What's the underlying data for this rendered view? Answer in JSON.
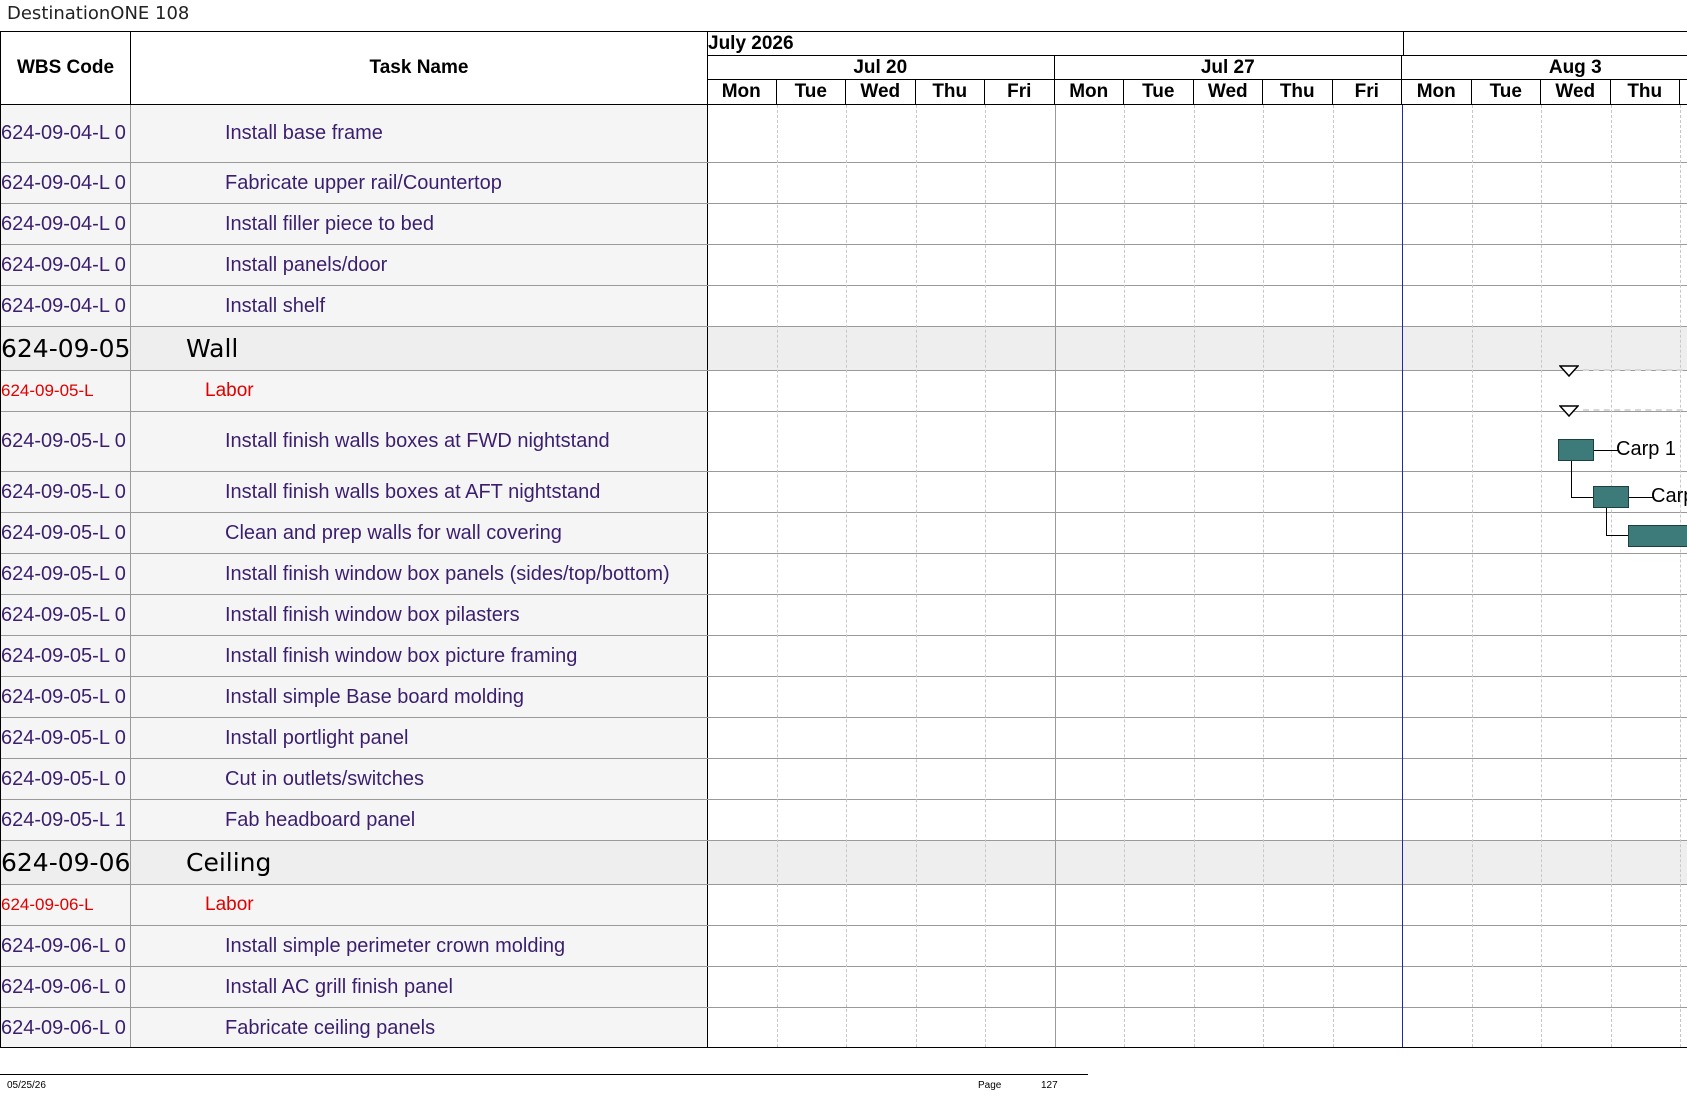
{
  "document": {
    "title": "DestinationONE 108"
  },
  "columns": {
    "wbs": "WBS Code",
    "task": "Task Name"
  },
  "timeline": {
    "month_label": "July 2026",
    "weeks": [
      "Jul 20",
      "Jul 27",
      "Aug 3"
    ],
    "days": [
      "Mon",
      "Tue",
      "Wed",
      "Thu",
      "Fri",
      "Mon",
      "Tue",
      "Wed",
      "Thu",
      "Fri",
      "Mon",
      "Tue",
      "Wed",
      "Thu"
    ]
  },
  "rows": [
    {
      "kind": "task",
      "wbs": "624-09-04-L 0",
      "name": "Install base frame"
    },
    {
      "kind": "task",
      "wbs": "624-09-04-L 0",
      "name": "Fabricate upper rail/Countertop"
    },
    {
      "kind": "task",
      "wbs": "624-09-04-L 0",
      "name": "Install filler piece to bed"
    },
    {
      "kind": "task",
      "wbs": "624-09-04-L 0",
      "name": "Install panels/door"
    },
    {
      "kind": "task",
      "wbs": "624-09-04-L 0",
      "name": "Install shelf"
    },
    {
      "kind": "group",
      "wbs": "624-09-05",
      "name": "Wall"
    },
    {
      "kind": "sub",
      "wbs": "624-09-05-L",
      "name": "Labor"
    },
    {
      "kind": "task",
      "wbs": "624-09-05-L 0",
      "name": "Install finish walls boxes at FWD nightstand"
    },
    {
      "kind": "task",
      "wbs": "624-09-05-L 0",
      "name": "Install finish walls boxes at AFT nightstand"
    },
    {
      "kind": "task",
      "wbs": "624-09-05-L 0",
      "name": "Clean and prep walls for wall covering"
    },
    {
      "kind": "task",
      "wbs": "624-09-05-L 0",
      "name": "Install finish window box panels (sides/top/bottom)"
    },
    {
      "kind": "task",
      "wbs": "624-09-05-L 0",
      "name": "Install finish window box pilasters"
    },
    {
      "kind": "task",
      "wbs": "624-09-05-L 0",
      "name": "Install finish window box picture framing"
    },
    {
      "kind": "task",
      "wbs": "624-09-05-L 0",
      "name": "Install simple Base board molding"
    },
    {
      "kind": "task",
      "wbs": "624-09-05-L 0",
      "name": "Install portlight panel"
    },
    {
      "kind": "task",
      "wbs": "624-09-05-L 0",
      "name": "Cut in outlets/switches"
    },
    {
      "kind": "task",
      "wbs": "624-09-05-L 1",
      "name": "Fab headboard panel"
    },
    {
      "kind": "group",
      "wbs": "624-09-06",
      "name": "Ceiling"
    },
    {
      "kind": "sub",
      "wbs": "624-09-06-L",
      "name": "Labor"
    },
    {
      "kind": "task",
      "wbs": "624-09-06-L 0",
      "name": "Install simple perimeter crown molding"
    },
    {
      "kind": "task",
      "wbs": "624-09-06-L 0",
      "name": "Install AC grill finish panel"
    },
    {
      "kind": "task",
      "wbs": "624-09-06-L 0",
      "name": "Fabricate ceiling panels"
    }
  ],
  "bars": [
    {
      "label": "Carp 1"
    },
    {
      "label": "Carp"
    }
  ],
  "footer": {
    "date": "05/25/26",
    "page_label": "Page",
    "page_number": "127"
  },
  "colors": {
    "bar": "#3d7a7a",
    "task_text": "#3b1f6e",
    "labor_text": "#e00000",
    "today_line": "#1c2aa8"
  }
}
